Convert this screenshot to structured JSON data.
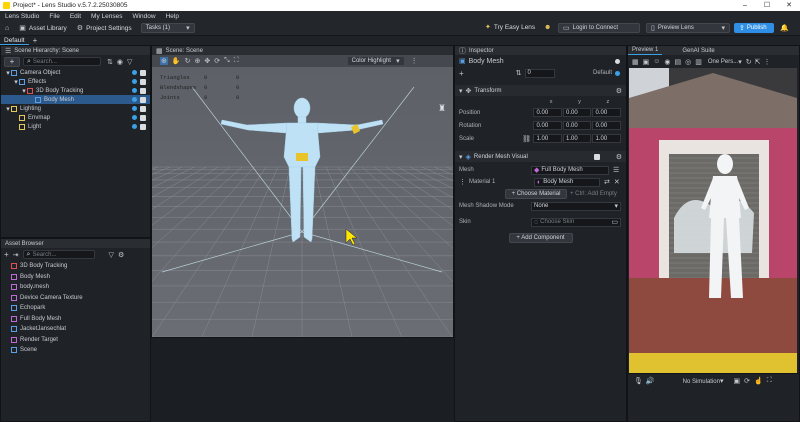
{
  "titlebar": {
    "title": "Project* - Lens Studio v.5.7.2.25030805",
    "minimize": "–",
    "maximize": "☐",
    "close": "✕"
  },
  "menu": [
    "Lens Studio",
    "File",
    "Edit",
    "My Lenses",
    "Window",
    "Help"
  ],
  "toolbar": {
    "asset_library": "Asset Library",
    "project_settings": "Project Settings",
    "tasks": "Tasks (1)",
    "try_easy_lens": "Try Easy Lens",
    "login": "Login to Connect",
    "preview_lens": "Preview Lens",
    "publish": "Publish"
  },
  "layout": {
    "name": "Default",
    "add": "+"
  },
  "hierarchy": {
    "title": "Scene Hierarchy: Scene",
    "search_placeholder": "Search...",
    "items": [
      {
        "label": "Camera Object",
        "depth": 0,
        "selected": false,
        "color": "#5aa0e6"
      },
      {
        "label": "Effects",
        "depth": 1,
        "selected": false,
        "color": "#5aa0e6"
      },
      {
        "label": "3D Body Tracking",
        "depth": 2,
        "selected": false,
        "color": "#e05050"
      },
      {
        "label": "Body Mesh",
        "depth": 3,
        "selected": true,
        "color": "#5aa0e6"
      },
      {
        "label": "Lighting",
        "depth": 0,
        "selected": false,
        "color": "#e6c85a"
      },
      {
        "label": "Envmap",
        "depth": 1,
        "selected": false,
        "color": "#e6c85a"
      },
      {
        "label": "Light",
        "depth": 1,
        "selected": false,
        "color": "#e6c85a"
      }
    ]
  },
  "assets": {
    "title": "Asset Browser",
    "search_placeholder": "Search...",
    "items": [
      {
        "label": "3D Body Tracking",
        "color": "#e05050"
      },
      {
        "label": "Body Mesh",
        "color": "#c06ad8"
      },
      {
        "label": "body.mesh",
        "color": "#c06ad8"
      },
      {
        "label": "Device Camera Texture",
        "color": "#c06ad8"
      },
      {
        "label": "Echopark",
        "color": "#5aa0e6"
      },
      {
        "label": "Full Body Mesh",
        "color": "#c06ad8"
      },
      {
        "label": "JacketJansechlat",
        "color": "#5aa0e6"
      },
      {
        "label": "Render Target",
        "color": "#c06ad8"
      },
      {
        "label": "Scene",
        "color": "#5aa0e6"
      }
    ]
  },
  "scene": {
    "title": "Scene: Scene",
    "highlight": "Color Highlight",
    "stats": [
      {
        "label": "Triangles",
        "value": "0",
        "value2": "0"
      },
      {
        "label": "Blendshapes",
        "value": "0",
        "value2": "0"
      },
      {
        "label": "Joints",
        "value": "0",
        "value2": "0"
      }
    ]
  },
  "inspector": {
    "title": "Inspector",
    "object_name": "Body Mesh",
    "layer_value": "0",
    "layer_label": "Default",
    "transform": {
      "title": "Transform",
      "headers": [
        "x",
        "y",
        "z"
      ],
      "rows": [
        {
          "label": "Position",
          "values": [
            "0.00",
            "0.00",
            "0.00"
          ]
        },
        {
          "label": "Rotation",
          "values": [
            "0.00",
            "0.00",
            "0.00"
          ]
        },
        {
          "label": "Scale",
          "values": [
            "1.00",
            "1.00",
            "1.00"
          ]
        }
      ]
    },
    "render_mesh": {
      "title": "Render Mesh Visual",
      "mesh_label": "Mesh",
      "mesh_value": "Full Body Mesh",
      "material_label": "Material 1",
      "material_value": "Body Mesh",
      "choose_material": "+ Choose Material",
      "add_hint": "+ Ctrl: Add Empty",
      "shadow_label": "Mesh Shadow Mode",
      "shadow_value": "None",
      "skin_label": "Skin",
      "skin_value": "Choose Skin"
    },
    "add_component": "+ Add Component"
  },
  "preview": {
    "tab1": "Preview 1",
    "tab2": "GenAI Suite",
    "device": "One Pers...",
    "simulation": "No Simulation"
  }
}
